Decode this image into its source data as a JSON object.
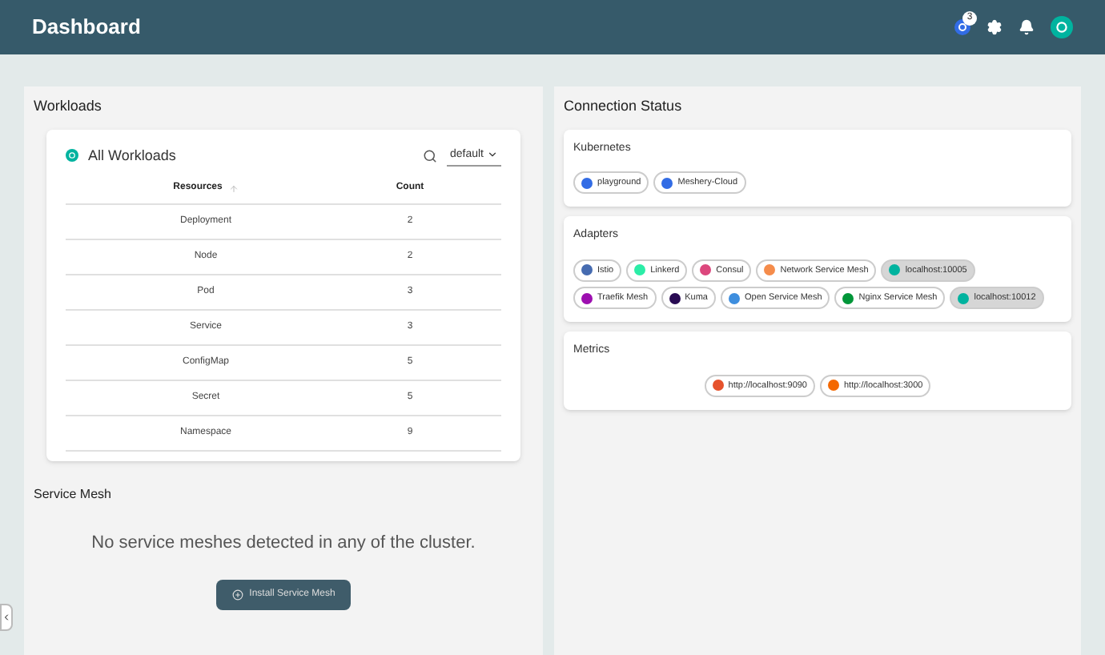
{
  "header": {
    "title": "Dashboard",
    "badge": "3"
  },
  "workloads": {
    "title": "Workloads",
    "card_title": "All Workloads",
    "namespace": "default",
    "columns": [
      "Resources",
      "Count"
    ],
    "rows": [
      {
        "resource": "Deployment",
        "count": "2"
      },
      {
        "resource": "Node",
        "count": "2"
      },
      {
        "resource": "Pod",
        "count": "3"
      },
      {
        "resource": "Service",
        "count": "3"
      },
      {
        "resource": "ConfigMap",
        "count": "5"
      },
      {
        "resource": "Secret",
        "count": "5"
      },
      {
        "resource": "Namespace",
        "count": "9"
      }
    ]
  },
  "service_mesh": {
    "title": "Service Mesh",
    "message": "No service meshes detected in any of the cluster.",
    "button": "Install Service Mesh"
  },
  "connection_status": {
    "title": "Connection Status",
    "sections": [
      {
        "title": "Kubernetes",
        "center": false,
        "chips": [
          {
            "label": "playground",
            "color": "#326ce5",
            "selected": false
          },
          {
            "label": "Meshery-Cloud",
            "color": "#326ce5",
            "selected": false
          }
        ]
      },
      {
        "title": "Adapters",
        "center": false,
        "chips": [
          {
            "label": "Istio",
            "color": "#466bb0",
            "selected": false
          },
          {
            "label": "Linkerd",
            "color": "#2beda7",
            "selected": false
          },
          {
            "label": "Consul",
            "color": "#dc477d",
            "selected": false
          },
          {
            "label": "Network Service Mesh",
            "color": "#f58c4b",
            "selected": false
          },
          {
            "label": "localhost:10005",
            "color": "#00b39f",
            "selected": true
          },
          {
            "label": "Traefik Mesh",
            "color": "#9d0fb0",
            "selected": false
          },
          {
            "label": "Kuma",
            "color": "#290b53",
            "selected": false
          },
          {
            "label": "Open Service Mesh",
            "color": "#3e8ede",
            "selected": false
          },
          {
            "label": "Nginx Service Mesh",
            "color": "#009639",
            "selected": false
          },
          {
            "label": "localhost:10012",
            "color": "#00b39f",
            "selected": true
          }
        ]
      },
      {
        "title": "Metrics",
        "center": true,
        "chips": [
          {
            "label": "http://localhost:9090",
            "color": "#e6522c",
            "selected": false
          },
          {
            "label": "http://localhost:3000",
            "color": "#f46800",
            "selected": false
          }
        ]
      }
    ]
  }
}
